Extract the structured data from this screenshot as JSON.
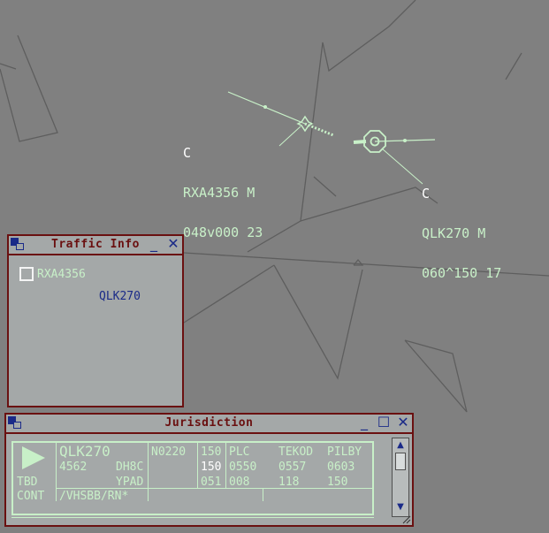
{
  "colors": {
    "background": "#808080",
    "label": "#c8f0c8",
    "header": "#ffffff",
    "window_border": "#6a1010",
    "accent": "#1a2a88"
  },
  "tracks": [
    {
      "header": "C",
      "line1": "RXA4356 M",
      "line2": "048v000 23"
    },
    {
      "header": "C",
      "line1": "QLK270 M",
      "line2": "060^150 17"
    }
  ],
  "traffic_info": {
    "title": "Traffic Info",
    "items": [
      {
        "label": "RXA4356",
        "color": "#c8f0c8",
        "checkbox": true
      },
      {
        "label": "QLK270",
        "color": "#1a2a88",
        "checkbox": false
      }
    ]
  },
  "jurisdiction": {
    "title": "Jurisdiction",
    "strip": {
      "callsign": "QLK270",
      "code": "4562",
      "type": "DH8C",
      "dest": "YPAD",
      "status1": "TBD",
      "status2": "CONT",
      "route": "/VHSBB/RN*",
      "time": "N0220",
      "alt1": "150",
      "alt2": "150",
      "alt3": "051",
      "fixes": [
        {
          "name": "PLC",
          "time": "0550",
          "level": "008"
        },
        {
          "name": "TEKOD",
          "time": "0557",
          "level": "118"
        },
        {
          "name": "PILBY",
          "time": "0603",
          "level": "150"
        }
      ]
    }
  }
}
